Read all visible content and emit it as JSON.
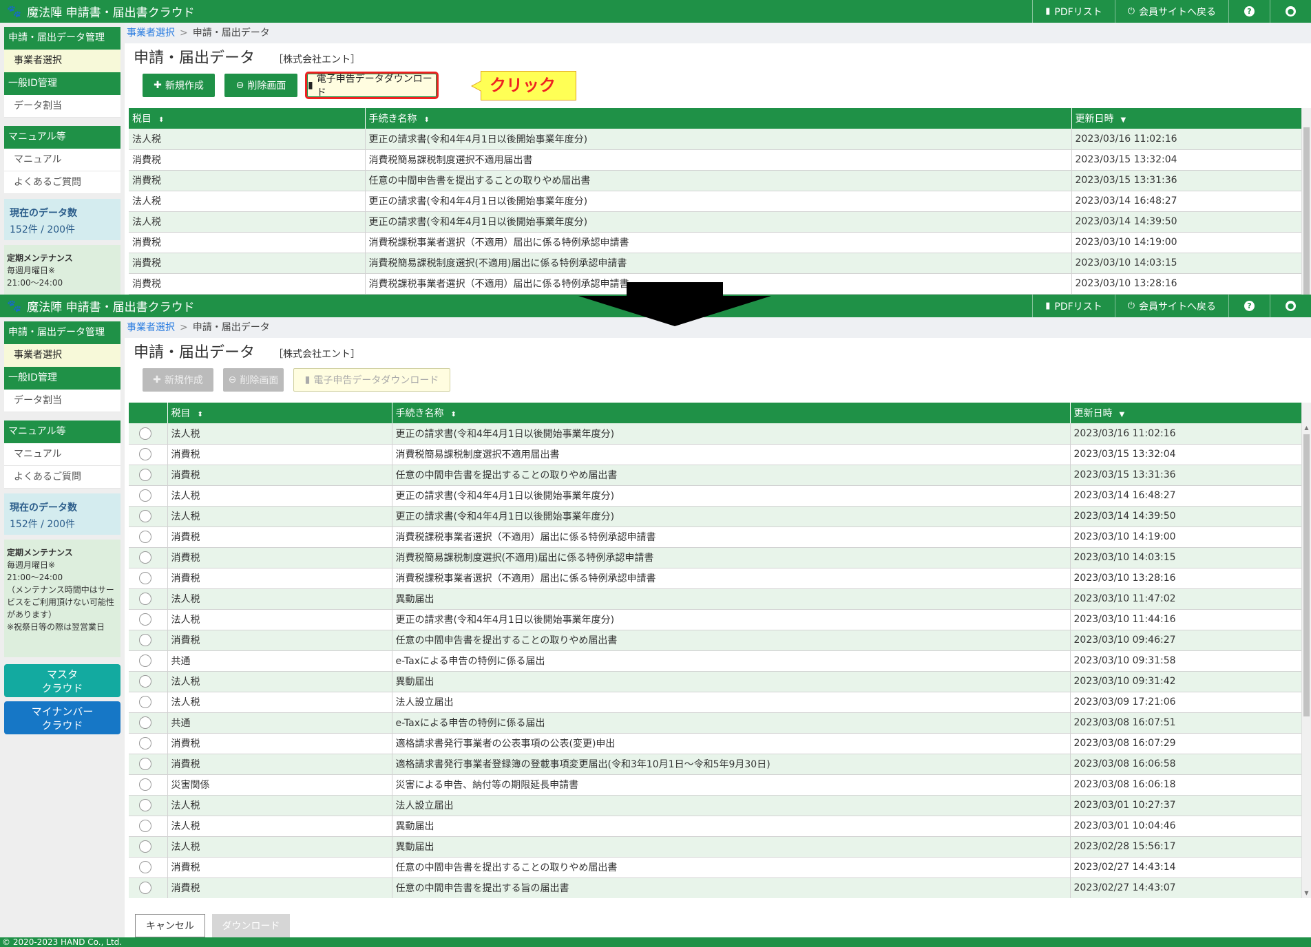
{
  "header": {
    "app_title": "魔法陣 申請書・届出書クラウド",
    "pdf_list": "PDFリスト",
    "member_site": "会員サイトへ戻る",
    "help_glyph": "?",
    "user_glyph": "●"
  },
  "sidebar": {
    "data_mgmt": "申請・届出データ管理",
    "select_business": "事業者選択",
    "general_id": "一般ID管理",
    "data_assign": "データ割当",
    "manual_etc": "マニュアル等",
    "manual": "マニュアル",
    "faq": "よくあるご質問",
    "count_title": "現在のデータ数",
    "count_value": "152件 / 200件",
    "maint_title": "定期メンテナンス",
    "maint_lines": [
      "毎週月曜日※",
      "21:00～24:00",
      "（メンテナンス時間中はサービスをご利用頂けない可能性があります）",
      "※祝祭日等の際は翌営業日"
    ],
    "master_cloud": [
      "マスタ",
      "クラウド"
    ],
    "mynumber_cloud": [
      "マイナンバー",
      "クラウド"
    ]
  },
  "breadcrumb": {
    "link": "事業者選択",
    "sep": ">",
    "current": "申請・届出データ"
  },
  "page": {
    "title": "申請・届出データ",
    "company": "［株式会社エント］"
  },
  "toolbar": {
    "new": "新規作成",
    "delete": "削除画面",
    "download": "電子申告データダウンロード",
    "callout": "クリック"
  },
  "table": {
    "col_tax": "税目",
    "col_proc": "手続き名称",
    "col_date": "更新日時",
    "rows": [
      {
        "tax": "法人税",
        "proc": "更正の請求書(令和4年4月1日以後開始事業年度分)",
        "date": "2023/03/16 11:02:16"
      },
      {
        "tax": "消費税",
        "proc": "消費税簡易課税制度選択不適用届出書",
        "date": "2023/03/15 13:32:04"
      },
      {
        "tax": "消費税",
        "proc": "任意の中間申告書を提出することの取りやめ届出書",
        "date": "2023/03/15 13:31:36"
      },
      {
        "tax": "法人税",
        "proc": "更正の請求書(令和4年4月1日以後開始事業年度分)",
        "date": "2023/03/14 16:48:27"
      },
      {
        "tax": "法人税",
        "proc": "更正の請求書(令和4年4月1日以後開始事業年度分)",
        "date": "2023/03/14 14:39:50"
      },
      {
        "tax": "消費税",
        "proc": "消費税課税事業者選択（不適用）届出に係る特例承認申請書",
        "date": "2023/03/10 14:19:00"
      },
      {
        "tax": "消費税",
        "proc": "消費税簡易課税制度選択(不適用)届出に係る特例承認申請書",
        "date": "2023/03/10 14:03:15"
      },
      {
        "tax": "消費税",
        "proc": "消費税課税事業者選択（不適用）届出に係る特例承認申請書",
        "date": "2023/03/10 13:28:16"
      },
      {
        "tax": "法人税",
        "proc": "異動届出",
        "date": "2023/03/10 11:47:02"
      },
      {
        "tax": "法人税",
        "proc": "更正の請求書(令和4年4月1日以後開始事業年度分)",
        "date": "2023/03/10 11:44:16"
      },
      {
        "tax": "消費税",
        "proc": "任意の中間申告書を提出することの取りやめ届出書",
        "date": "2023/03/10 09:46:27"
      },
      {
        "tax": "共通",
        "proc": "e-Taxによる申告の特例に係る届出",
        "date": "2023/03/10 09:31:58"
      },
      {
        "tax": "法人税",
        "proc": "異動届出",
        "date": "2023/03/10 09:31:42"
      },
      {
        "tax": "法人税",
        "proc": "法人設立届出",
        "date": "2023/03/09 17:21:06"
      },
      {
        "tax": "共通",
        "proc": "e-Taxによる申告の特例に係る届出",
        "date": "2023/03/08 16:07:51"
      },
      {
        "tax": "消費税",
        "proc": "適格請求書発行事業者の公表事項の公表(変更)申出",
        "date": "2023/03/08 16:07:29"
      },
      {
        "tax": "消費税",
        "proc": "適格請求書発行事業者登録簿の登載事項変更届出(令和3年10月1日～令和5年9月30日)",
        "date": "2023/03/08 16:06:58"
      },
      {
        "tax": "災害関係",
        "proc": "災害による申告、納付等の期限延長申請書",
        "date": "2023/03/08 16:06:18"
      },
      {
        "tax": "法人税",
        "proc": "法人設立届出",
        "date": "2023/03/01 10:27:37"
      },
      {
        "tax": "法人税",
        "proc": "異動届出",
        "date": "2023/03/01 10:04:46"
      },
      {
        "tax": "法人税",
        "proc": "異動届出",
        "date": "2023/02/28 15:56:17"
      },
      {
        "tax": "消費税",
        "proc": "任意の中間申告書を提出することの取りやめ届出書",
        "date": "2023/02/27 14:43:14"
      },
      {
        "tax": "消費税",
        "proc": "任意の中間申告書を提出する旨の届出書",
        "date": "2023/02/27 14:43:07"
      }
    ]
  },
  "footer": {
    "cancel": "キャンセル",
    "download": "ダウンロード"
  },
  "copyright": "© 2020-2023 HAND Co., Ltd.",
  "colors": {
    "brand_green": "#1f9147",
    "highlight_red": "#ee2222",
    "callout_yellow": "#ffff55"
  },
  "icons": [
    "paw-icon",
    "pdf-icon",
    "power-icon",
    "help-icon",
    "user-icon",
    "plus-icon",
    "minus-circle-icon",
    "file-icon",
    "sort-icon",
    "sort-desc-icon",
    "down-arrow-icon"
  ]
}
